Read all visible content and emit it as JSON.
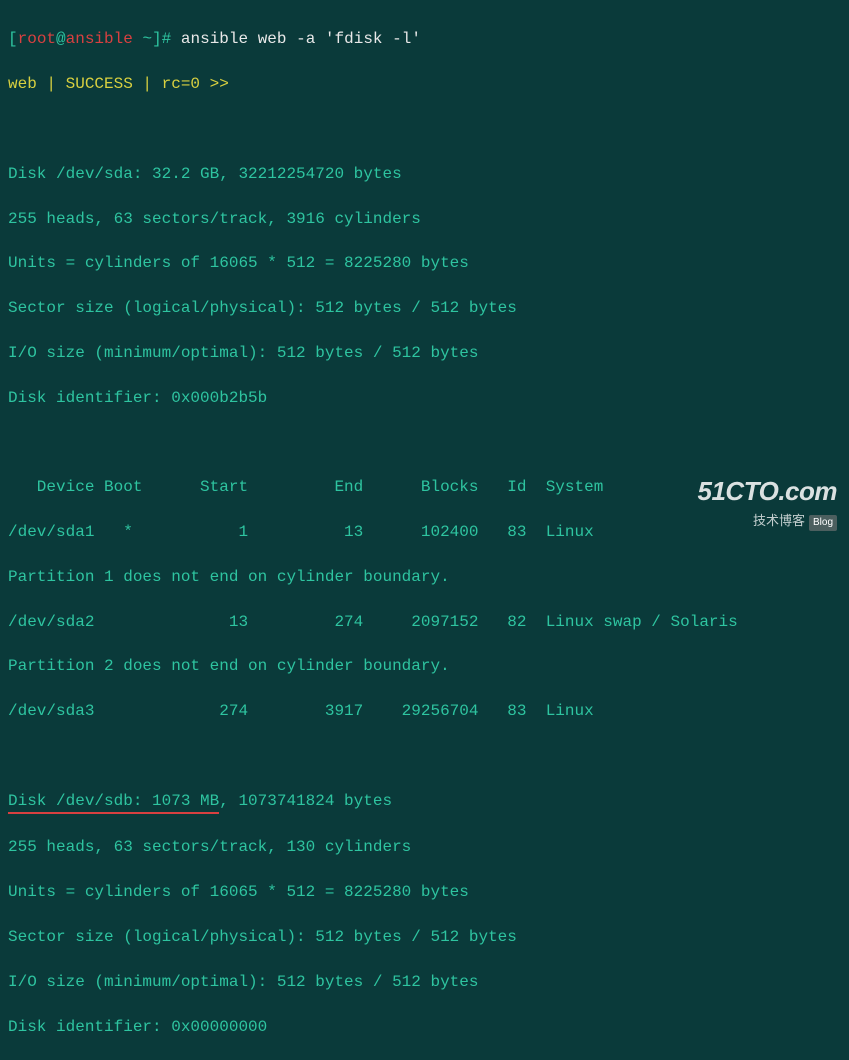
{
  "prompt": {
    "user": "root",
    "host": "ansible",
    "path": "~",
    "symbol": "#",
    "command": "ansible web -a 'fdisk -l'"
  },
  "status_line": "web | SUCCESS | rc=0 >>",
  "disk1": {
    "header": "Disk /dev/sda: 32.2 GB, 32212254720 bytes",
    "geometry": "255 heads, 63 sectors/track, 3916 cylinders",
    "units": "Units = cylinders of 16065 * 512 = 8225280 bytes",
    "sector": "Sector size (logical/physical): 512 bytes / 512 bytes",
    "io": "I/O size (minimum/optimal): 512 bytes / 512 bytes",
    "id": "Disk identifier: 0x000b2b5b"
  },
  "table": {
    "header": "   Device Boot      Start         End      Blocks   Id  System",
    "row1": "/dev/sda1   *           1          13      102400   83  Linux",
    "note1": "Partition 1 does not end on cylinder boundary.",
    "row2": "/dev/sda2              13         274     2097152   82  Linux swap / Solaris",
    "note2": "Partition 2 does not end on cylinder boundary.",
    "row3": "/dev/sda3             274        3917    29256704   83  Linux"
  },
  "disk2": {
    "header_underlined": "Disk /dev/sdb: 1073 MB",
    "header_rest": ", 1073741824 bytes",
    "geometry": "255 heads, 63 sectors/track, 130 cylinders",
    "units": "Units = cylinders of 16065 * 512 = 8225280 bytes",
    "sector": "Sector size (logical/physical): 512 bytes / 512 bytes",
    "io": "I/O size (minimum/optimal): 512 bytes / 512 bytes",
    "id": "Disk identifier: 0x00000000"
  },
  "watermark": {
    "main": "51CTO.com",
    "sub": "技术博客",
    "tag": "Blog"
  }
}
